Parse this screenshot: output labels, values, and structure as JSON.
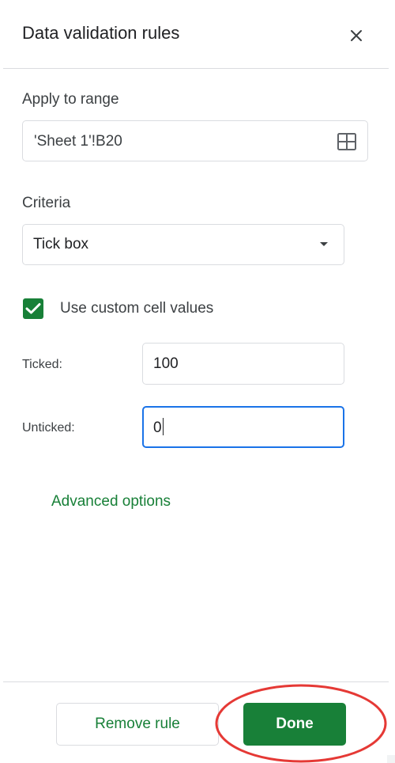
{
  "header": {
    "title": "Data validation rules",
    "close_icon": "close-icon"
  },
  "apply_to_range": {
    "label": "Apply to range",
    "value": "'Sheet 1'!B20",
    "icon": "grid-select-icon"
  },
  "criteria": {
    "label": "Criteria",
    "selected": "Tick box",
    "icon": "dropdown-arrow-icon"
  },
  "custom_values": {
    "checked": true,
    "label": "Use custom cell values"
  },
  "ticked": {
    "label": "Ticked:",
    "value": "100"
  },
  "unticked": {
    "label": "Unticked:",
    "value": "0"
  },
  "advanced_options": {
    "label": "Advanced options"
  },
  "footer": {
    "remove_label": "Remove rule",
    "done_label": "Done"
  },
  "colors": {
    "accent_green": "#188038",
    "focus_blue": "#1a73e8",
    "annotation_red": "#e53935"
  }
}
